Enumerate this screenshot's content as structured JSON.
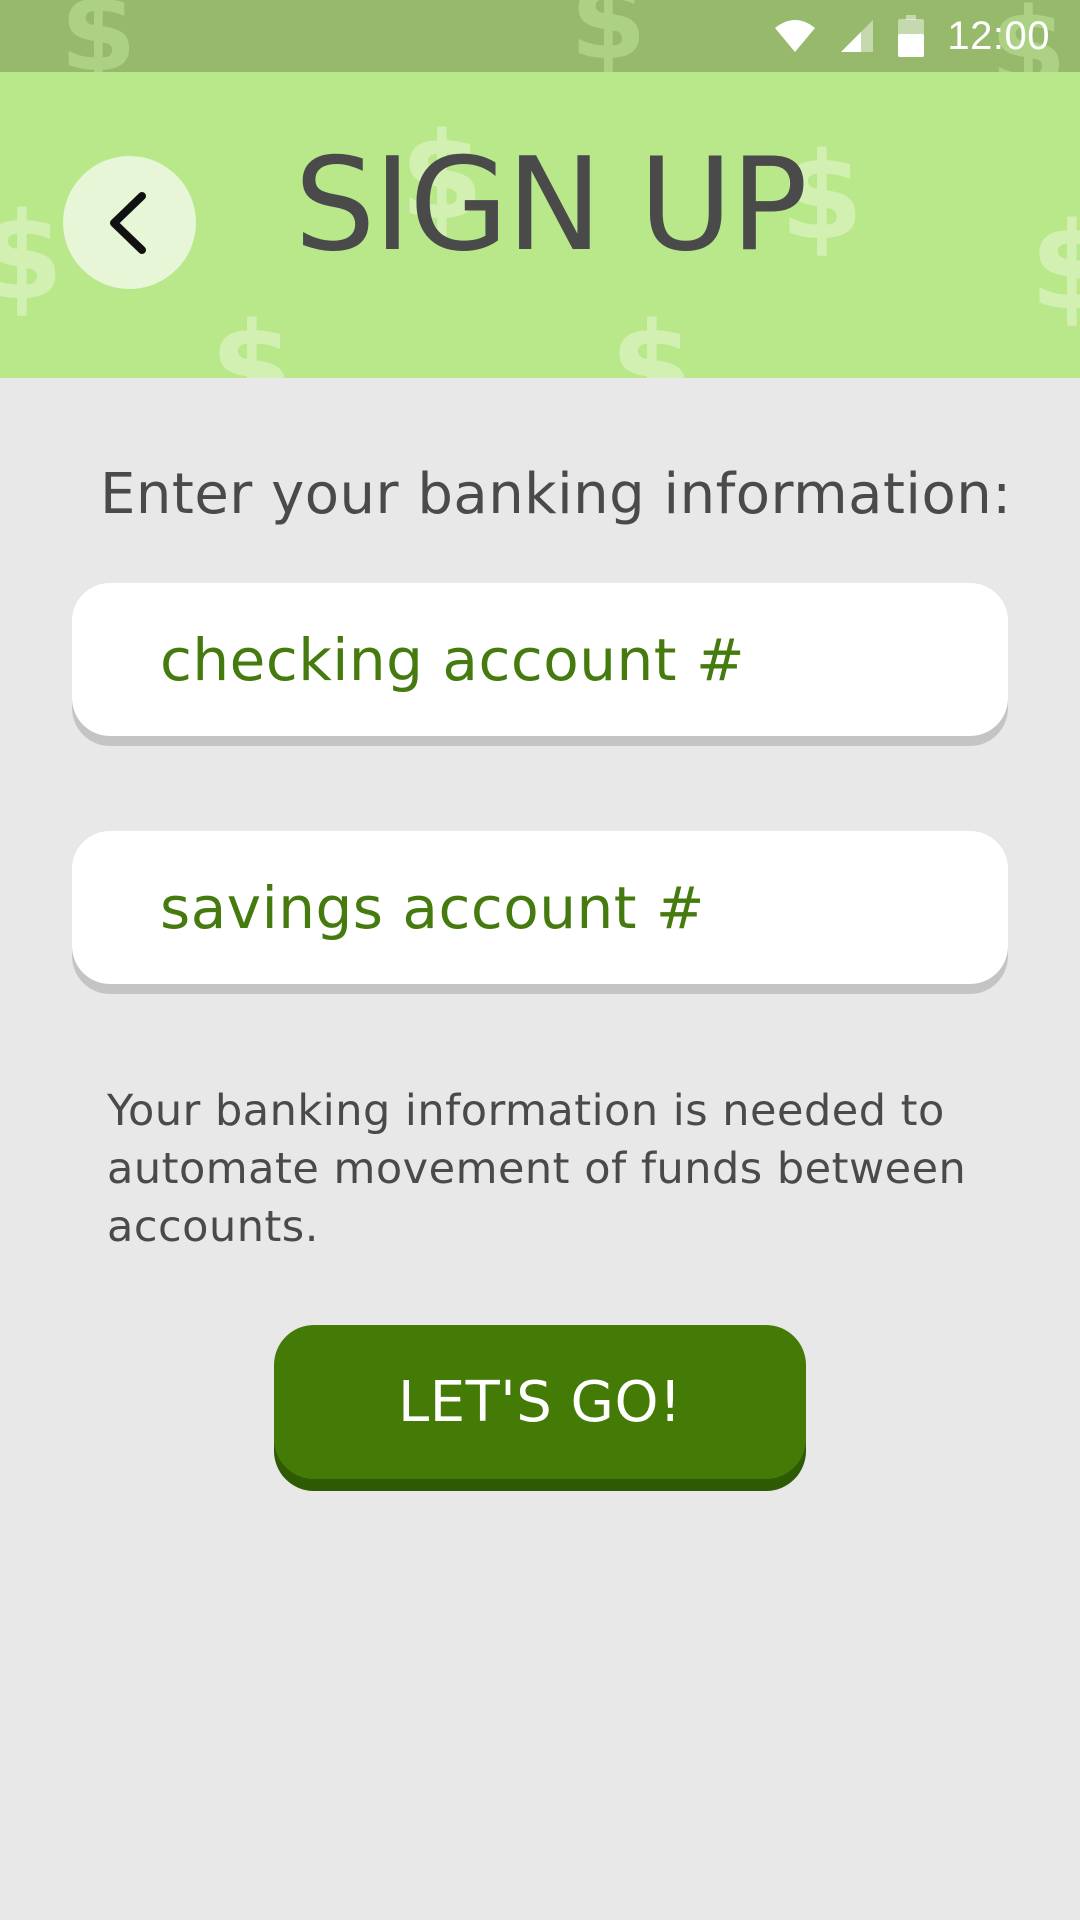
{
  "status_bar": {
    "time": "12:00",
    "icons": [
      "wifi-icon",
      "cell-signal-icon",
      "battery-icon"
    ]
  },
  "header": {
    "title": "SIGN UP",
    "back_icon": "chevron-left-icon",
    "pattern_icon": "dollar-sign-icon"
  },
  "form": {
    "prompt": "Enter your banking information:",
    "checking_placeholder": "checking account #",
    "checking_value": "",
    "savings_placeholder": "savings account #",
    "savings_value": "",
    "info_text": "Your banking information is needed to automate movement of funds between accounts.",
    "submit_label": "LET'S GO!"
  },
  "colors": {
    "status_bar": "#96b96c",
    "header": "#b8e88a",
    "background": "#e8e8e8",
    "accent": "#447a06",
    "text": "#4a4a4a"
  }
}
